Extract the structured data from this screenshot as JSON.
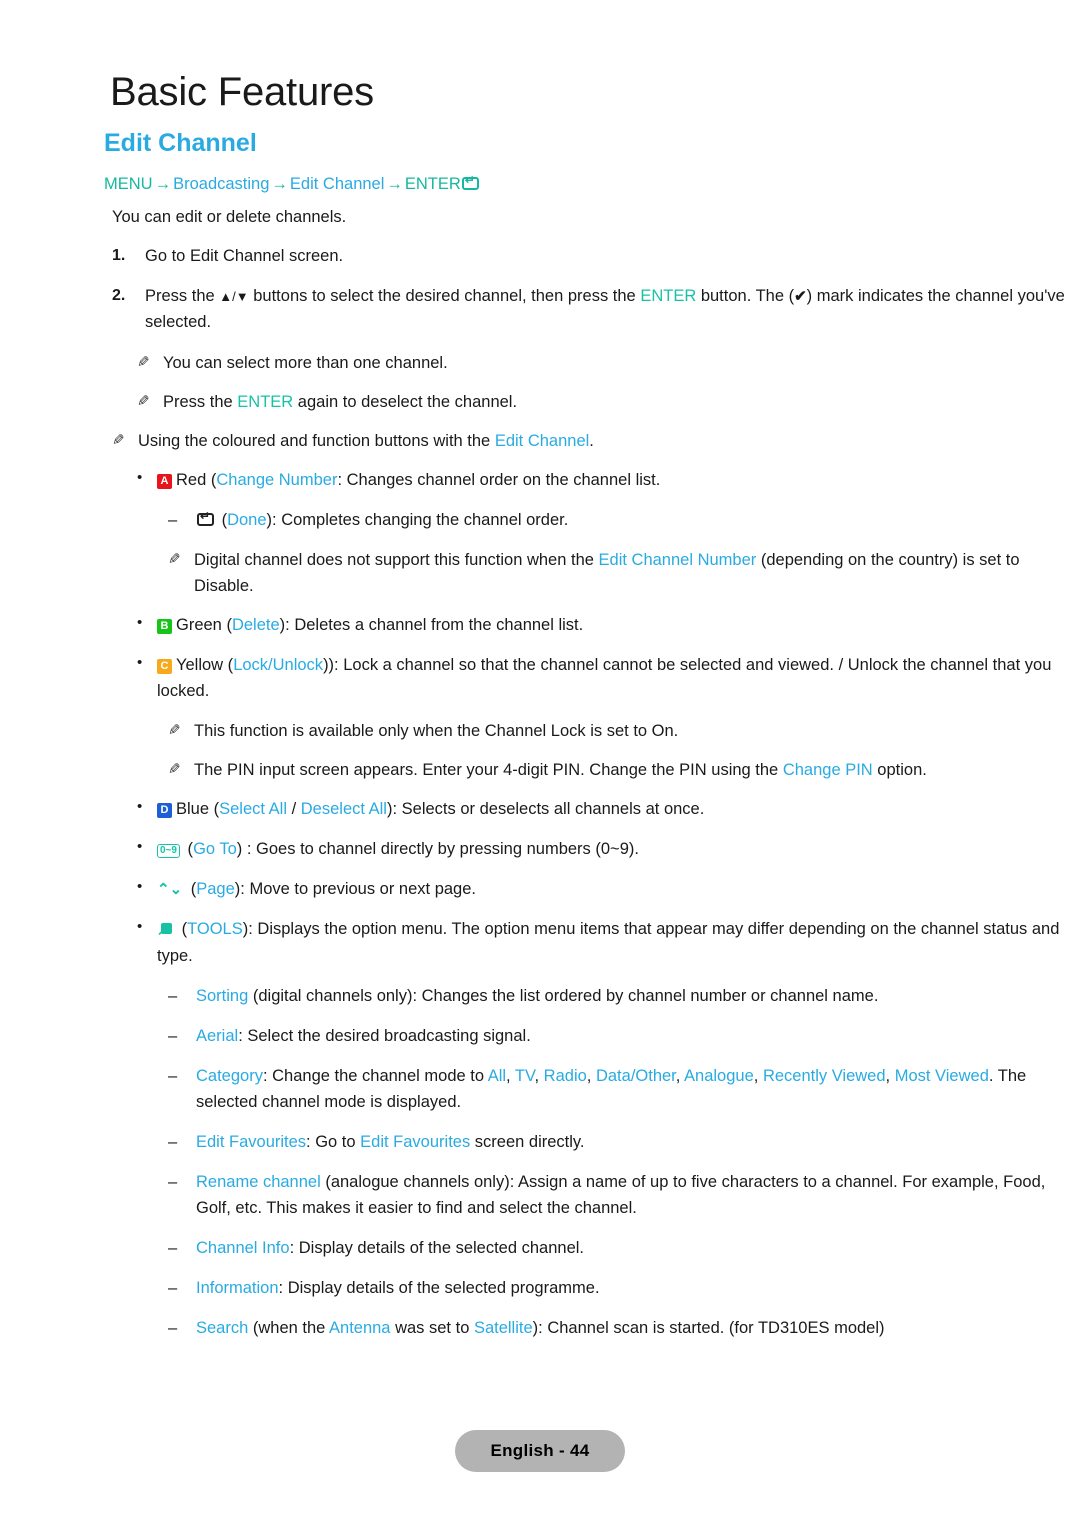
{
  "chapter_title": "Basic Features",
  "section_title": "Edit Channel",
  "breadcrumb": {
    "menu": "MENU",
    "arrow": "→",
    "broadcasting": "Broadcasting",
    "edit_channel": "Edit Channel",
    "enter": "ENTER"
  },
  "intro": "You can edit or delete channels.",
  "steps": [
    {
      "num": "1.",
      "text": "Go to Edit Channel screen."
    },
    {
      "num": "2.",
      "pre": "Press the ",
      "arrows": "▲/▼",
      "mid1": " buttons to select the desired channel, then press the ",
      "enter": "ENTER",
      "mid2": " button. The (",
      "check": "✔",
      "post": ") mark indicates the channel you've selected."
    }
  ],
  "step2_notes": [
    {
      "text": "You can select more than one channel."
    },
    {
      "pre": "Press the ",
      "enter": "ENTER",
      "post": " again to deselect the channel."
    }
  ],
  "coloured_intro": {
    "pre": "Using the coloured and function buttons with the ",
    "link": "Edit Channel",
    "post": "."
  },
  "buttons": [
    {
      "badge": "A",
      "badge_color": "#E8131B",
      "name": "Red",
      "label": "Change Number",
      "desc": ": Changes channel order on the channel list.",
      "sub_dash": {
        "icon": "enter-return-icon",
        "label": "Done",
        "desc": "): Completes changing the channel order.",
        "open_paren": " ("
      },
      "sub_note": {
        "pre": "Digital channel does not support this function when the ",
        "link": "Edit Channel Number",
        "post": " (depending on the country) is set to Disable."
      }
    },
    {
      "badge": "B",
      "badge_color": "#19C419",
      "name": "Green",
      "label": "Delete",
      "desc": "): Deletes a channel from the channel list."
    },
    {
      "badge": "C",
      "badge_color": "#F7A81B",
      "name": "Yellow",
      "label": "Lock/Unlock",
      "desc": ")): Lock a channel so that the channel cannot be selected and viewed. / Unlock the channel that you locked.",
      "notes": [
        {
          "text": "This function is available only when the Channel Lock is set to On."
        },
        {
          "pre": "The PIN input screen appears. Enter your 4-digit PIN. Change the PIN using the ",
          "link": "Change PIN",
          "post": " option."
        }
      ]
    },
    {
      "badge": "D",
      "badge_color": "#1E5FD8",
      "name": "Blue",
      "label_a": "Select All",
      "separator": " / ",
      "label_b": "Deselect All",
      "desc": "): Selects or deselects all channels at once."
    }
  ],
  "function_buttons": [
    {
      "icon": "keypad-0-9-icon",
      "icon_text": "0~9",
      "label": "Go To",
      "desc": ") : Goes to channel directly by pressing numbers (0~9)."
    },
    {
      "icon": "page-updown-icon",
      "icon_text": "⌃⌄",
      "label": "Page",
      "desc": "): Move to previous or next page."
    },
    {
      "icon": "tools-icon",
      "label": "TOOLS",
      "desc": "): Displays the option menu. The option menu items that appear may differ depending on the channel status and type."
    }
  ],
  "tools_options": [
    {
      "label": "Sorting",
      "desc": " (digital channels only): Changes the list ordered by channel number or channel name."
    },
    {
      "label": "Aerial",
      "desc": ": Select the desired broadcasting signal."
    },
    {
      "label": "Category",
      "desc_pre": ": Change the channel mode to ",
      "modes": [
        "All",
        "TV",
        "Radio",
        "Data/Other",
        "Analogue",
        "Recently Viewed",
        "Most Viewed"
      ],
      "desc_post": ". The selected channel mode is displayed."
    },
    {
      "label": "Edit Favourites",
      "desc_pre": ": Go to ",
      "link": "Edit Favourites",
      "desc_post": " screen directly."
    },
    {
      "label": "Rename channel",
      "desc": " (analogue channels only): Assign a name of up to five characters to a channel. For example, Food, Golf, etc. This makes it easier to find and select the channel."
    },
    {
      "label": "Channel Info",
      "desc": ": Display details of the selected channel."
    },
    {
      "label": "Information",
      "desc": ": Display details of the selected programme."
    },
    {
      "label": "Search",
      "desc_pre": " (when the ",
      "link_a": "Antenna",
      "desc_mid": " was set to ",
      "link_b": "Satellite",
      "desc_post": "): Channel scan is started. (for TD310ES model)"
    }
  ],
  "footer": {
    "page_label": "English - 44"
  },
  "colors": {
    "accent_blue": "#29ABE2",
    "accent_teal": "#17C2A4",
    "badge_red": "#E8131B",
    "badge_green": "#19C419",
    "badge_yellow": "#F7A81B",
    "badge_blue": "#1E5FD8",
    "footer_bg": "#b3b3b3"
  },
  "paren": {
    "open": " (",
    "close": ")"
  },
  "glyphs": {
    "bullet": "•",
    "dash": "–",
    "pencil": "✎"
  }
}
